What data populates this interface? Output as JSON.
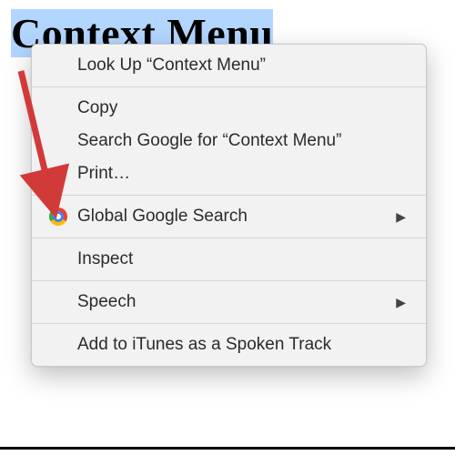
{
  "page": {
    "selected_heading": "Context Menu"
  },
  "menu": {
    "lookup": "Look Up “Context Menu”",
    "copy": "Copy",
    "search_google": "Search Google for “Context Menu”",
    "print": "Print…",
    "global_google_search": "Global Google Search",
    "inspect": "Inspect",
    "speech": "Speech",
    "add_to_itunes": "Add to iTunes as a Spoken Track"
  },
  "icons": {
    "chrome": "chrome-icon",
    "submenu_glyph": "▶"
  },
  "annotation": {
    "arrow_color": "#d23a3a"
  }
}
